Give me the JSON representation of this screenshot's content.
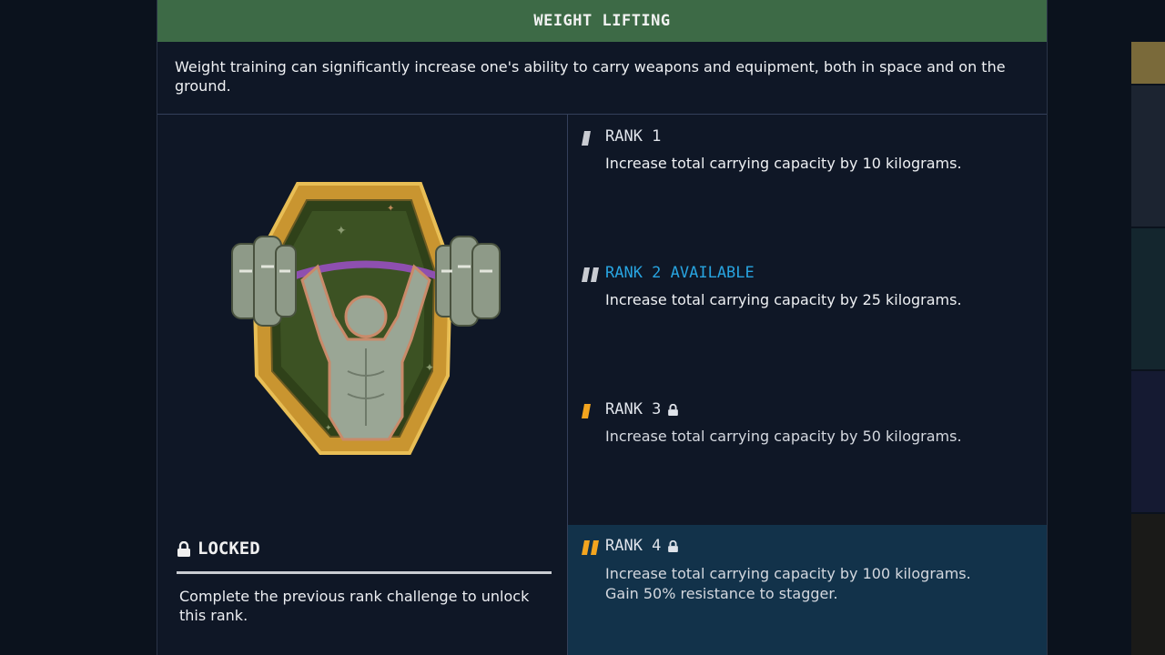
{
  "header": {
    "title": "WEIGHT LIFTING"
  },
  "description": "Weight training can significantly increase one's ability to carry weapons and equipment, both in space and on the ground.",
  "status": {
    "label": "LOCKED",
    "text": "Complete the previous rank challenge to unlock this rank."
  },
  "ranks": [
    {
      "title": "RANK 1",
      "desc": "Increase total carrying capacity by 10 kilograms.",
      "state": "unlocked",
      "color": "#c9ccd2"
    },
    {
      "title": "RANK 2 AVAILABLE",
      "desc": "Increase total carrying capacity by 25 kilograms.",
      "state": "available",
      "color": "#28a4e0"
    },
    {
      "title": "RANK 3",
      "desc": "Increase total carrying capacity by 50 kilograms.",
      "state": "locked",
      "color": "#f3a51f"
    },
    {
      "title": "RANK 4",
      "desc": "Increase total carrying capacity by 100 kilograms.\nGain 50% resistance to stagger.",
      "state": "locked",
      "color": "#f3a51f"
    }
  ],
  "colors": {
    "header_bg": "#3d6a46",
    "panel_bg": "#0f1726",
    "highlight_bg": "#12324a",
    "available": "#28a4e0",
    "locked_mark": "#f3a51f",
    "badge_gold": "#e0ad3c",
    "badge_green": "#3c4f22"
  },
  "icons": {
    "badge": "weight-lifter-patch-icon",
    "lock": "lock-icon",
    "rank_mark": "rank-tick-icon"
  }
}
